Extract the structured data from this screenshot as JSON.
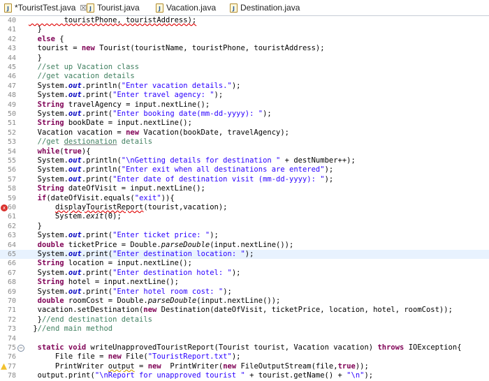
{
  "tabs": [
    {
      "label": "*TouristTest.java",
      "active": true,
      "close": "☒"
    },
    {
      "label": "Tourist.java"
    },
    {
      "label": "Vacation.java"
    },
    {
      "label": "Destination.java"
    }
  ],
  "editor": {
    "current_line": 65,
    "lines": [
      {
        "n": "40",
        "text": "        touristPhone, touristAddress);"
      },
      {
        "n": "41",
        "text": "  }"
      },
      {
        "n": "42",
        "text": "  else {"
      },
      {
        "n": "43",
        "text": "  tourist = new Tourist(touristName, touristPhone, touristAddress);"
      },
      {
        "n": "44",
        "text": "  }"
      },
      {
        "n": "45",
        "text": "  //set up Vacation class"
      },
      {
        "n": "46",
        "text": "  //get vacation details"
      },
      {
        "n": "47",
        "text": "  System.out.println(\"Enter vacation details.\");"
      },
      {
        "n": "48",
        "text": "  System.out.print(\"Enter travel agency: \");"
      },
      {
        "n": "49",
        "text": "  String travelAgency = input.nextLine();"
      },
      {
        "n": "50",
        "text": "  System.out.print(\"Enter booking date(mm-dd-yyyy): \");"
      },
      {
        "n": "51",
        "text": "  String bookDate = input.nextLine();"
      },
      {
        "n": "52",
        "text": "  Vacation vacation = new Vacation(bookDate, travelAgency);"
      },
      {
        "n": "53",
        "text": "  //get destionation details"
      },
      {
        "n": "54",
        "text": "  while(true){"
      },
      {
        "n": "55",
        "text": "  System.out.println(\"\\nGetting details for destination \" + destNumber++);"
      },
      {
        "n": "56",
        "text": "  System.out.println(\"Enter exit when all destinations are entered\");"
      },
      {
        "n": "57",
        "text": "  System.out.print(\"Enter date of destination visit (mm-dd-yyyy): \");"
      },
      {
        "n": "58",
        "text": "  String dateOfVisit = input.nextLine();"
      },
      {
        "n": "59",
        "text": "  if(dateOfVisit.equals(\"exit\")){"
      },
      {
        "n": "60",
        "text": "      displayTouristReport(tourist,vacation);"
      },
      {
        "n": "61",
        "text": "      System.exit(0);"
      },
      {
        "n": "62",
        "text": "  }"
      },
      {
        "n": "63",
        "text": "  System.out.print(\"Enter ticket price: \");"
      },
      {
        "n": "64",
        "text": "  double ticketPrice = Double.parseDouble(input.nextLine());"
      },
      {
        "n": "65",
        "text": "  System.out.print(\"Enter destination location: \");"
      },
      {
        "n": "66",
        "text": "  String location = input.nextLine();"
      },
      {
        "n": "67",
        "text": "  System.out.print(\"Enter destination hotel: \");"
      },
      {
        "n": "68",
        "text": "  String hotel = input.nextLine();"
      },
      {
        "n": "69",
        "text": "  System.out.print(\"Enter hotel room cost: \");"
      },
      {
        "n": "70",
        "text": "  double roomCost = Double.parseDouble(input.nextLine());"
      },
      {
        "n": "71",
        "text": "  vacation.setDestination(new Destination(dateOfVisit, ticketPrice, location, hotel, roomCost));"
      },
      {
        "n": "72",
        "text": "  }//end destination details"
      },
      {
        "n": "73",
        "text": " }//end main method"
      },
      {
        "n": "74",
        "text": ""
      },
      {
        "n": "75",
        "text": "  static void writeUnapprovedTouristReport(Tourist tourist, Vacation vacation) throws IOException{"
      },
      {
        "n": "76",
        "text": "      File file = new File(\"TouristReport.txt\");"
      },
      {
        "n": "77",
        "text": "      PrintWriter output = new  PrintWriter(new FileOutputStream(file,true));"
      },
      {
        "n": "78",
        "text": "  output.print(\"\\nReport for unapproved tourist \" + tourist.getName() + \"\\n\");"
      }
    ]
  },
  "markers": {
    "error_line": "60",
    "warning_line": "77",
    "fold_line": "75"
  },
  "colors": {
    "keyword": "#7f0055",
    "string": "#2a00ff",
    "comment": "#3f7f5f",
    "field": "#0000c0",
    "current_line_bg": "#e8f2fe"
  }
}
